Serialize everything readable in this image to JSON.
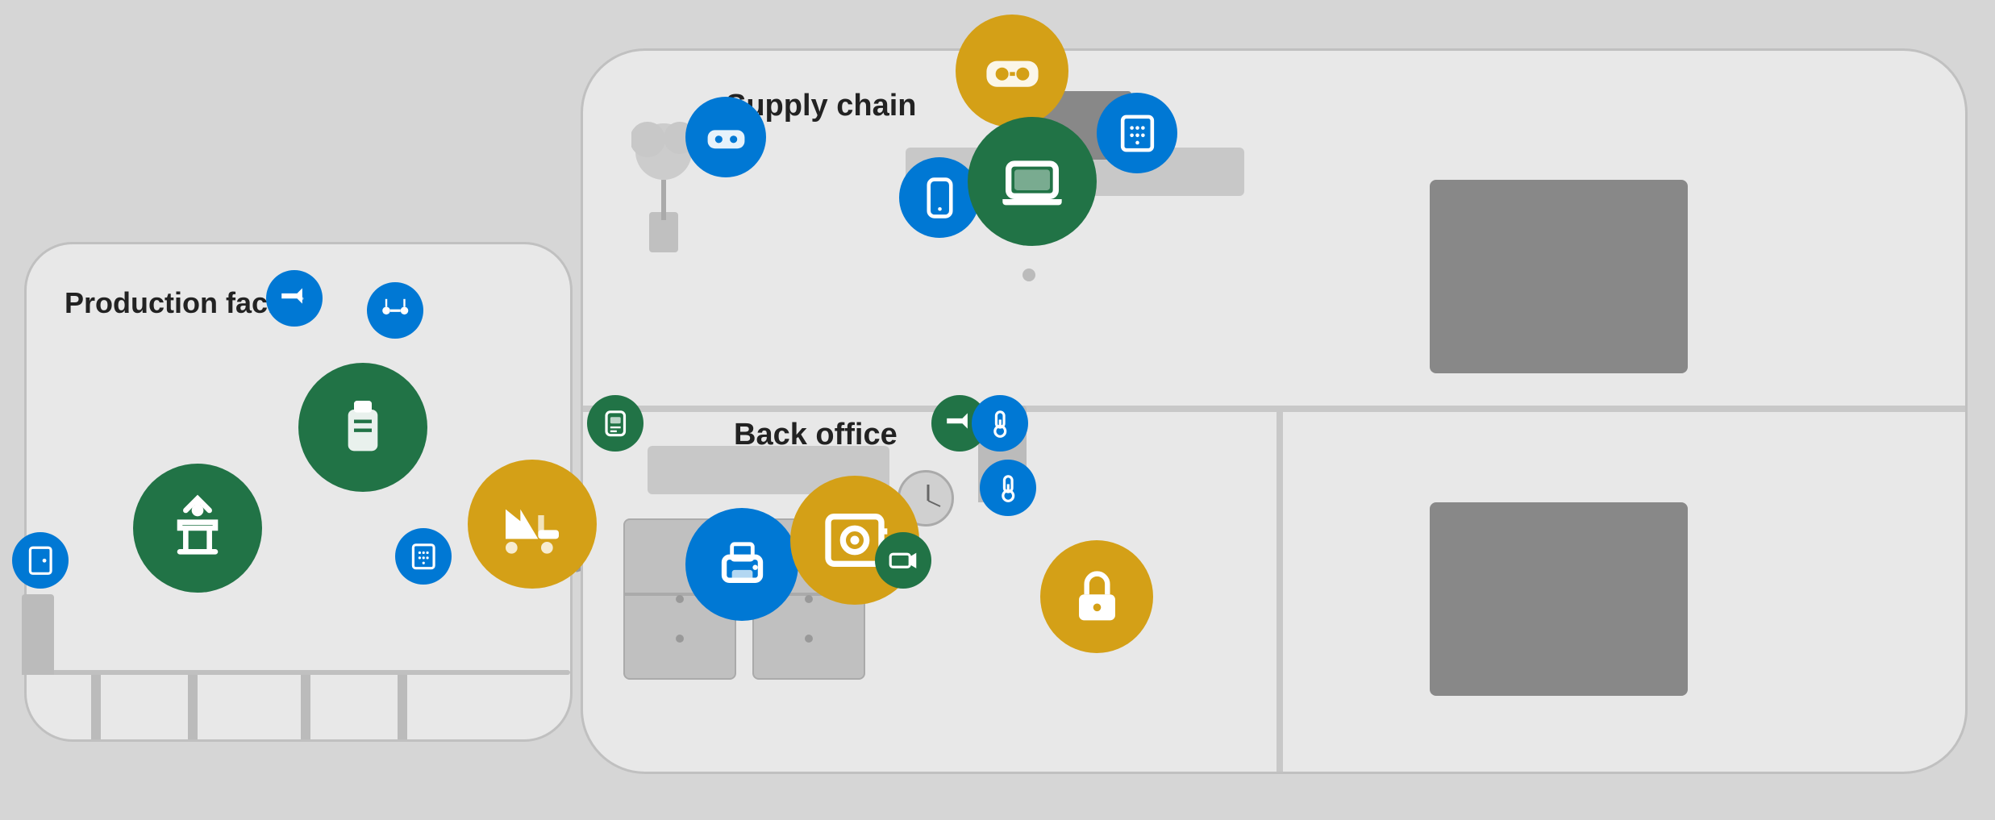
{
  "labels": {
    "production_facility": "Production facility",
    "back_office": "Back office",
    "supply_chain": "Supply chain"
  },
  "colors": {
    "blue": "#0078d4",
    "green": "#217346",
    "gold": "#d4a017",
    "bg": "#d6d6d6",
    "building": "#e8e8e8"
  },
  "icons": {
    "camera": "camera-icon",
    "laptop": "laptop-icon",
    "phone": "phone-icon",
    "robot_arm": "robot-arm-icon",
    "tank": "tank-icon",
    "forklift": "forklift-icon",
    "keypad": "keypad-icon",
    "printer": "printer-icon",
    "safe": "safe-icon",
    "security_cam": "security-camera-icon",
    "lock": "lock-icon",
    "thermometer": "thermometer-icon",
    "switch": "switch-icon",
    "vr_headset": "vr-headset-icon",
    "conveyor": "conveyor-icon",
    "door_sensor": "door-sensor-icon",
    "badge_reader": "badge-reader-icon"
  }
}
